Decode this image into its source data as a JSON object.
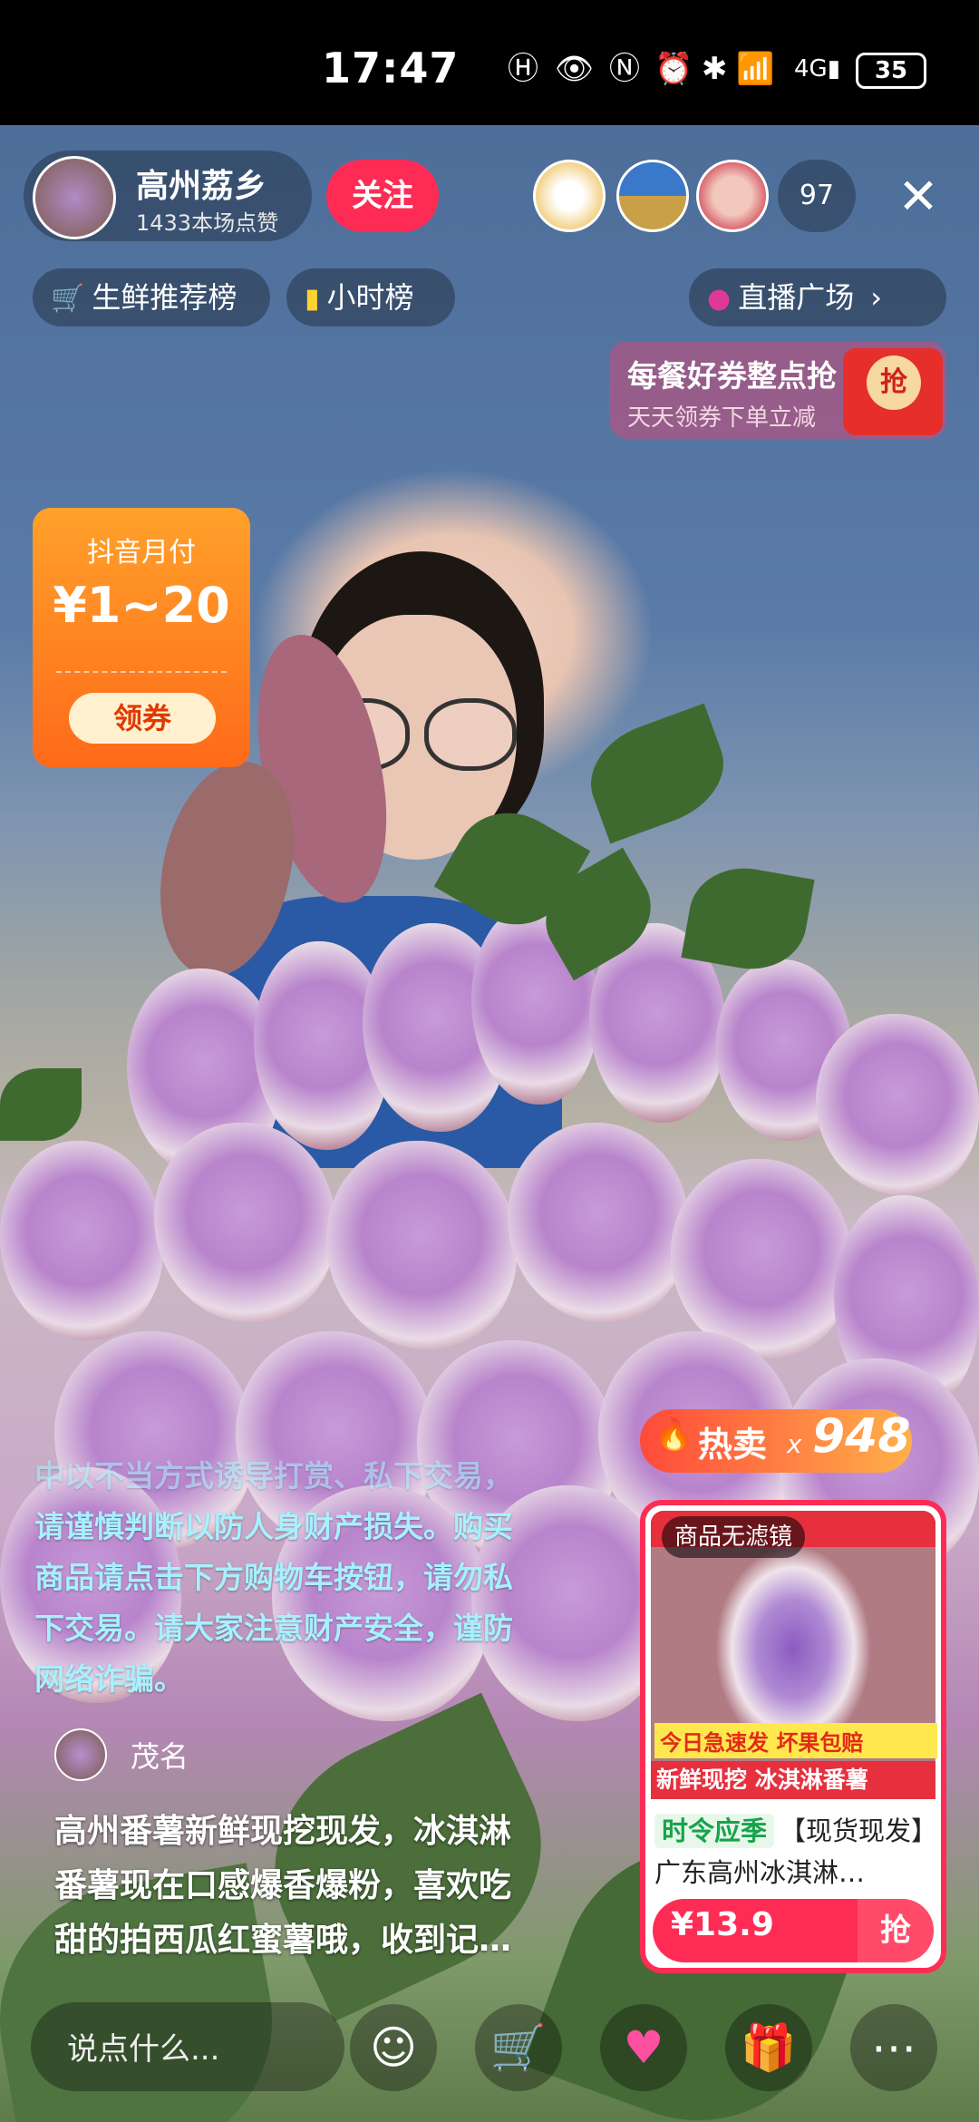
{
  "status_bar": {
    "time": "17:47",
    "battery": "35",
    "icons": [
      "hd-icon",
      "eye-icon",
      "nfc-icon",
      "alarm-icon",
      "bluetooth-icon",
      "wifi-icon",
      "signal-icon"
    ]
  },
  "host": {
    "name": "高州荔乡",
    "likes": "1433本场点赞",
    "follow_label": "关注"
  },
  "viewers": {
    "count": "97"
  },
  "chips": {
    "fresh_rank": "生鲜推荐榜",
    "hour_rank": "小时榜",
    "live_plaza": "直播广场"
  },
  "coupon_banner": {
    "title": "每餐好券整点抢",
    "subtitle": "天天领券下单立减",
    "button": "抢"
  },
  "pay_card": {
    "title": "抖音月付",
    "amount": "¥1~20",
    "button": "领券"
  },
  "notice": {
    "faded_line": "中以不当方式诱导打赏、私下交易，",
    "lines": [
      "请谨慎判断以防人身财产损失。购买",
      "商品请点击下方购物车按钮，请勿私",
      "下交易。请大家注意财产安全，谨防",
      "网络诈骗。"
    ]
  },
  "comment": {
    "user": "茂名",
    "lines": [
      "高州番薯新鲜现挖现发，冰淇淋",
      "番薯现在口感爆香爆粉，喜欢吃",
      "甜的拍西瓜红蜜薯哦，收到记…"
    ]
  },
  "product": {
    "hot_label": "热卖",
    "hot_x": "x",
    "hot_count": "948",
    "filter_tag": "商品无滤镜",
    "img_caption1": "今日急速发 坏果包赔",
    "img_caption2": "新鲜现挖 冰淇淋番薯",
    "season_tag": "时令应季",
    "title": "【现货现发】广东高州冰淇淋…",
    "price": "¥13.9",
    "buy_label": "抢"
  },
  "bottom_bar": {
    "placeholder": "说点什么..."
  },
  "colors": {
    "accent": "#fe2c55",
    "notice": "#a7f0ff",
    "pay_orange": "#ff6a1a"
  }
}
